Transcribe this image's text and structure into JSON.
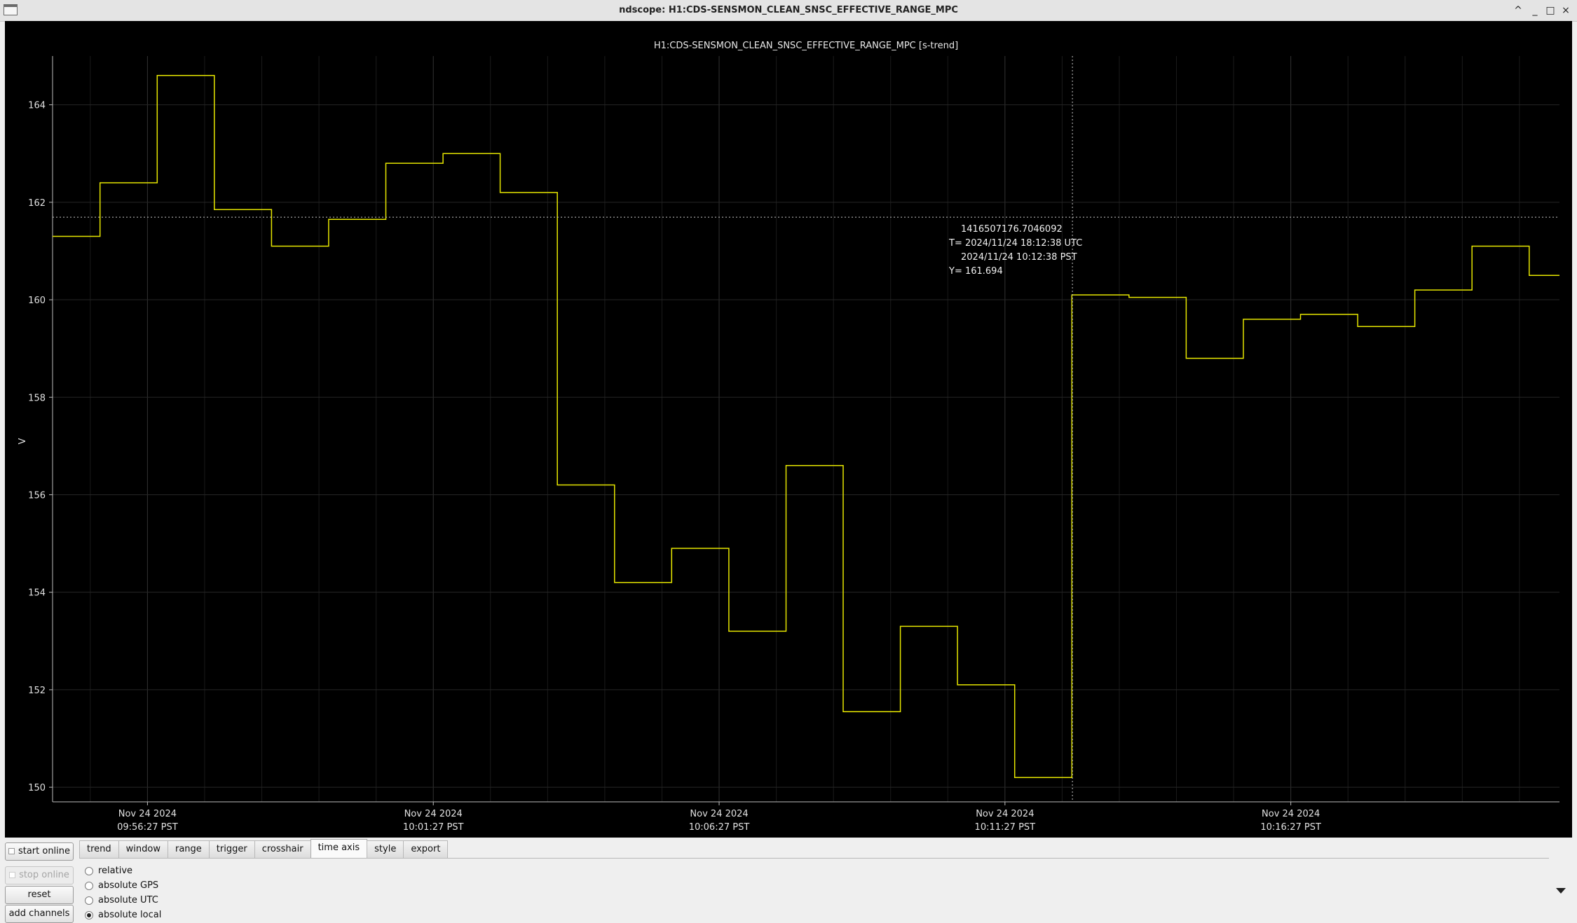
{
  "window": {
    "title": "ndscope: H1:CDS-SENSMON_CLEAN_SNSC_EFFECTIVE_RANGE_MPC",
    "buttons": [
      "^",
      "_",
      "□",
      "×"
    ]
  },
  "plot": {
    "title": "H1:CDS-SENSMON_CLEAN_SNSC_EFFECTIVE_RANGE_MPC [s-trend]",
    "ylabel": "V",
    "y_ticks": [
      "164",
      "162",
      "160",
      "158",
      "156",
      "154",
      "152",
      "150"
    ],
    "x_ticks": [
      {
        "date": "Nov 24 2024",
        "time": "09:56:27 PST"
      },
      {
        "date": "Nov 24 2024",
        "time": "10:01:27 PST"
      },
      {
        "date": "Nov 24 2024",
        "time": "10:06:27 PST"
      },
      {
        "date": "Nov 24 2024",
        "time": "10:11:27 PST"
      },
      {
        "date": "Nov 24 2024",
        "time": "10:16:27 PST"
      }
    ],
    "crosshair": {
      "gps": "1416507176.7046092",
      "utc": "T= 2024/11/24 18:12:38 UTC",
      "local": "2024/11/24 10:12:38 PST",
      "y": "Y= 161.694"
    },
    "colors": {
      "background": "#000000",
      "trace": "#e6e600",
      "grid": "#2a2a2a",
      "axis": "#bdbdbd",
      "crosshair": "#c8c8c8"
    }
  },
  "chart_data": {
    "type": "line",
    "title": "H1:CDS-SENSMON_CLEAN_SNSC_EFFECTIVE_RANGE_MPC [s-trend]",
    "xlabel": "",
    "ylabel": "V",
    "x_unit": "minutes relative to Nov 24 2024 09:56:27 PST",
    "ylim": [
      149.7,
      165.0
    ],
    "xlim": [
      -1.66,
      24.7
    ],
    "grid": true,
    "series": [
      {
        "name": "H1:CDS-SENSMON_CLEAN_SNSC_EFFECTIVE_RANGE_MPC",
        "color": "#e6e600",
        "points": [
          [
            -1.66,
            161.3
          ],
          [
            -0.83,
            161.3
          ],
          [
            -0.83,
            162.4
          ],
          [
            0.17,
            162.4
          ],
          [
            0.17,
            164.6
          ],
          [
            1.17,
            164.6
          ],
          [
            1.17,
            161.85
          ],
          [
            2.17,
            161.85
          ],
          [
            2.17,
            161.1
          ],
          [
            3.17,
            161.1
          ],
          [
            3.17,
            161.65
          ],
          [
            4.17,
            161.65
          ],
          [
            4.17,
            162.8
          ],
          [
            5.17,
            162.8
          ],
          [
            5.17,
            163.0
          ],
          [
            6.17,
            163.0
          ],
          [
            6.17,
            162.2
          ],
          [
            7.17,
            162.2
          ],
          [
            7.17,
            156.2
          ],
          [
            8.17,
            156.2
          ],
          [
            8.17,
            154.2
          ],
          [
            9.17,
            154.2
          ],
          [
            9.17,
            154.9
          ],
          [
            10.17,
            154.9
          ],
          [
            10.17,
            153.2
          ],
          [
            11.17,
            153.2
          ],
          [
            11.17,
            156.6
          ],
          [
            12.17,
            156.6
          ],
          [
            12.17,
            151.55
          ],
          [
            13.17,
            151.55
          ],
          [
            13.17,
            153.3
          ],
          [
            14.17,
            153.3
          ],
          [
            14.17,
            152.1
          ],
          [
            15.17,
            152.1
          ],
          [
            15.17,
            150.2
          ],
          [
            16.17,
            150.2
          ],
          [
            16.17,
            160.1
          ],
          [
            17.17,
            160.1
          ],
          [
            17.17,
            160.05
          ],
          [
            18.17,
            160.05
          ],
          [
            18.17,
            158.8
          ],
          [
            19.17,
            158.8
          ],
          [
            19.17,
            159.6
          ],
          [
            20.17,
            159.6
          ],
          [
            20.17,
            159.7
          ],
          [
            21.17,
            159.7
          ],
          [
            21.17,
            159.45
          ],
          [
            22.17,
            159.45
          ],
          [
            22.17,
            160.2
          ],
          [
            23.17,
            160.2
          ],
          [
            23.17,
            161.1
          ],
          [
            24.17,
            161.1
          ],
          [
            24.17,
            160.5
          ],
          [
            24.7,
            160.5
          ]
        ]
      }
    ],
    "crosshair": {
      "x": 16.18,
      "y": 161.694
    }
  },
  "controls": {
    "start_online": "start online",
    "stop_online": "stop online",
    "reset": "reset",
    "add_channels": "add channels",
    "tabs": [
      "trend",
      "window",
      "range",
      "trigger",
      "crosshair",
      "time axis",
      "style",
      "export"
    ],
    "active_tab": "time axis",
    "time_axis_options": [
      "relative",
      "absolute GPS",
      "absolute UTC",
      "absolute local"
    ],
    "selected_option": "absolute local"
  }
}
